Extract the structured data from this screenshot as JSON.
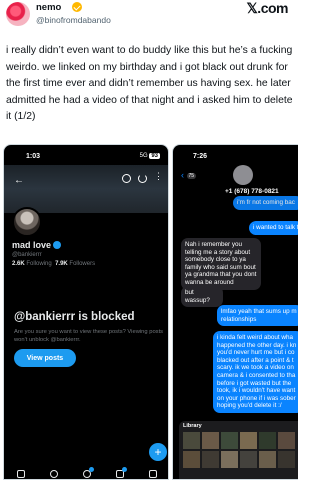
{
  "tweet": {
    "display_name": "nemo",
    "handle": "@binofromdabando",
    "brand": "𝕏.com",
    "text": "i really didn’t even want to do buddy like this but he’s a fucking weirdo. we linked on my birthday and i got black out drunk for the first time ever and didn’t remember us having sex. he later admitted he had a video of that night and i asked him to delete it (1/2)"
  },
  "screenshot_left": {
    "status_time": "1:03",
    "status_right": "5G",
    "battery": "93",
    "profile": {
      "name": "mad love",
      "handle": "@bankierrr",
      "following_count": "2.6K",
      "following_label": "Following",
      "followers_count": "7.9K",
      "followers_label": "Followers"
    },
    "blocked_title": "@bankierrr is blocked",
    "blocked_desc": "Are you sure you want to view these posts? Viewing posts won't unblock @bankierrr.",
    "view_posts_label": "View posts",
    "fab_label": "+"
  },
  "screenshot_right": {
    "status_time": "7:26",
    "back_count": "75",
    "contact_number": "+1 (678) 778-0821",
    "messages": [
      {
        "dir": "out",
        "text": "i'm fr not coming bac"
      },
      {
        "dir": "out",
        "text": "i wanted to talk t"
      },
      {
        "dir": "in",
        "text": "Nah i remember you telling me a story about somebody close to ya family who said sum bout ya grandma that you dont wanna be around"
      },
      {
        "dir": "in",
        "text": "but wassup?"
      },
      {
        "dir": "out",
        "text": "lmfao yeah that sums up m relationships"
      },
      {
        "dir": "out",
        "text": "i kinda felt weird about wha happened the other day. i kn you'd never hurt me but i co blacked out after a point & t scary. ik we took a video on camera & i consented to tha before i got wasted but the took, ik i wouldn't have want on your phone if i was sober hoping you'd delete it :/"
      }
    ],
    "library_label": "Library"
  },
  "colors": {
    "x_blue": "#1d9bf0",
    "imessage_blue": "#0a84ff",
    "incoming_gray": "#26252a"
  }
}
